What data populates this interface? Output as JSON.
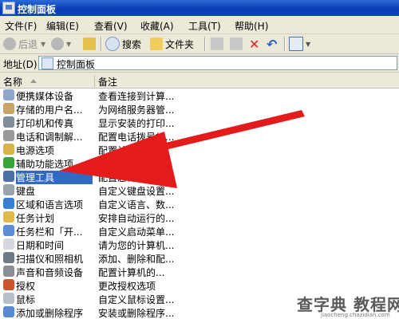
{
  "window": {
    "title": "控制面板"
  },
  "menu": [
    "文件(F)",
    "编辑(E)",
    "查看(V)",
    "收藏(A)",
    "工具(T)",
    "帮助(H)"
  ],
  "toolbar": {
    "back_label": "后退",
    "search_label": "搜索",
    "folders_label": "文件夹"
  },
  "address": {
    "label": "地址(D)",
    "value": "控制面板"
  },
  "columns": {
    "name": "名称",
    "remark": "备注"
  },
  "items": [
    {
      "name": "便携媒体设备",
      "desc": "查看连接到计算...",
      "icon": "portable-media-icon",
      "color": "#8ea6c9"
    },
    {
      "name": "存储的用户名...",
      "desc": "为网络服务器管...",
      "icon": "stored-users-icon",
      "color": "#c9a46b"
    },
    {
      "name": "打印机和传真",
      "desc": "显示安装的打印...",
      "icon": "printer-icon",
      "color": "#7f8c99"
    },
    {
      "name": "电话和调制解...",
      "desc": "配置电话拨号规...",
      "icon": "phone-modem-icon",
      "color": "#9a9a9a"
    },
    {
      "name": "电源选项",
      "desc": "配置计...",
      "icon": "power-options-icon",
      "color": "#d8b548"
    },
    {
      "name": "辅助功能选项",
      "desc": "为...",
      "icon": "accessibility-icon",
      "color": "#3aa33a"
    },
    {
      "name": "管理工具",
      "desc": "配置您计算机的...",
      "icon": "admin-tools-icon",
      "color": "#4d6fa8"
    },
    {
      "name": "键盘",
      "desc": "自定义键盘设置...",
      "icon": "keyboard-icon",
      "color": "#9aa4ae"
    },
    {
      "name": "区域和语言选项",
      "desc": "自定义语言、数...",
      "icon": "region-language-icon",
      "color": "#3b7fd1"
    },
    {
      "name": "任务计划",
      "desc": "安排自动运行的...",
      "icon": "scheduled-tasks-icon",
      "color": "#e0b94a"
    },
    {
      "name": "任务栏和「开...",
      "desc": "自定义启动菜单...",
      "icon": "taskbar-icon",
      "color": "#5b8ed6"
    },
    {
      "name": "日期和时间",
      "desc": "请为您的计算机...",
      "icon": "date-time-icon",
      "color": "#d5d9df"
    },
    {
      "name": "扫描仪和照相机",
      "desc": "添加、删除和配...",
      "icon": "scanner-camera-icon",
      "color": "#6e7a86"
    },
    {
      "name": "声音和音频设备",
      "desc": "配置计算机的...",
      "icon": "sound-icon",
      "color": "#8a8f95"
    },
    {
      "name": "授权",
      "desc": "更改授权选项",
      "icon": "licensing-icon",
      "color": "#c9562f"
    },
    {
      "name": "鼠标",
      "desc": "自定义鼠标设置...",
      "icon": "mouse-icon",
      "color": "#b8bfc6"
    },
    {
      "name": "添加或删除程序",
      "desc": "安装或删除程序...",
      "icon": "add-remove-programs-icon",
      "color": "#5a8ad0"
    }
  ],
  "selected_index": 6,
  "watermark": {
    "main": "查字典 教程网",
    "sub": "jiaocheng.chazidian.com"
  }
}
